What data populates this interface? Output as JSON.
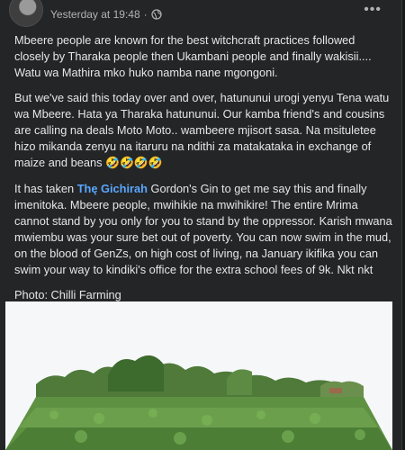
{
  "post": {
    "timestamp": "Yesterday at 19:48",
    "separator": "·",
    "more_label": "•••",
    "p1": "Mbeere people are known for the best witchcraft practices followed closely by Tharaka people then Ukambani people and finally wakisii.... Watu wa Mathira mko huko namba nane mgongoni.",
    "p2": "But we've said this today over and over, hatununui urogi yenyu Tena watu wa Mbeere. Hata ya Tharaka hatununui. Our kamba friend's and cousins are calling na deals Moto Moto.. wambeere mjisort sasa. Na msituletee hizo mikanda zenyu na itaruru na ndithi za matakataka in exchange of maize and beans",
    "p2_emojis": "🤣🤣🤣🤣",
    "p3_before": "It has taken ",
    "p3_mention": "Thę Gichirah",
    "p3_after": "  Gordon's Gin to get me say this and finally imenitoka. Mbeere people, mwihikie na mwihikire! The entire Mrima cannot stand by you only for you to stand by the oppressor. Karish mwana mwiembu was your sure bet out of poverty. You can now swim in the mud, on the blood of GenZs, on high cost of living, na January ikifika you can swim your way to kindiki's office for the extra school fees of 9k. Nkt nkt",
    "photo_credit": "Photo: Chilli Farming"
  },
  "colors": {
    "background": "#242526",
    "text": "#e4e6eb",
    "meta": "#b0b3b8",
    "mention": "#5aa7ff"
  },
  "icons": {
    "privacy": "globe-icon",
    "menu": "more-options-icon"
  }
}
